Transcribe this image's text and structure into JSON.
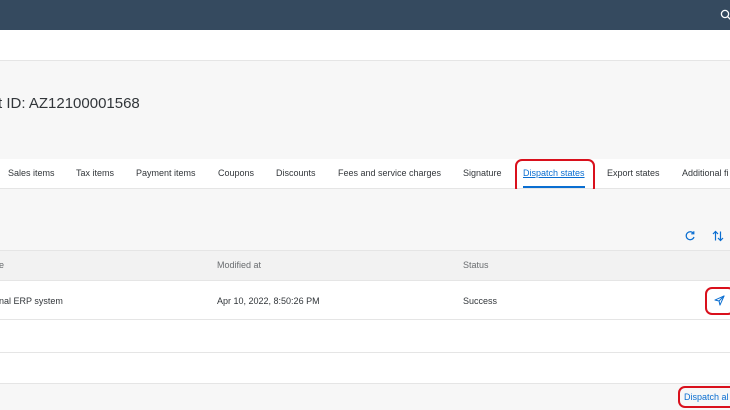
{
  "shell": {
    "search_icon": "search-icon"
  },
  "header": {
    "title": "t ID: AZ12100001568"
  },
  "tabs": [
    {
      "label": "Sales items"
    },
    {
      "label": "Tax items"
    },
    {
      "label": "Payment items"
    },
    {
      "label": "Coupons"
    },
    {
      "label": "Discounts"
    },
    {
      "label": "Fees and service charges"
    },
    {
      "label": "Signature"
    },
    {
      "label": "Dispatch states",
      "selected": true
    },
    {
      "label": "Export states"
    },
    {
      "label": "Additional fi"
    }
  ],
  "toolbar": {
    "refresh_icon": "refresh-icon",
    "sort_icon": "sort-icon"
  },
  "table": {
    "columns": [
      "e",
      "Modified at",
      "Status"
    ],
    "rows": [
      {
        "name": "nal ERP system",
        "modified_at": "Apr 10, 2022, 8:50:26 PM",
        "status": "Success",
        "action_icon": "send-icon"
      }
    ]
  },
  "footer": {
    "dispatch_label": "Dispatch al"
  },
  "colors": {
    "shell": "#354a5f",
    "accent": "#0a6ed1",
    "highlight": "#d9101c"
  }
}
